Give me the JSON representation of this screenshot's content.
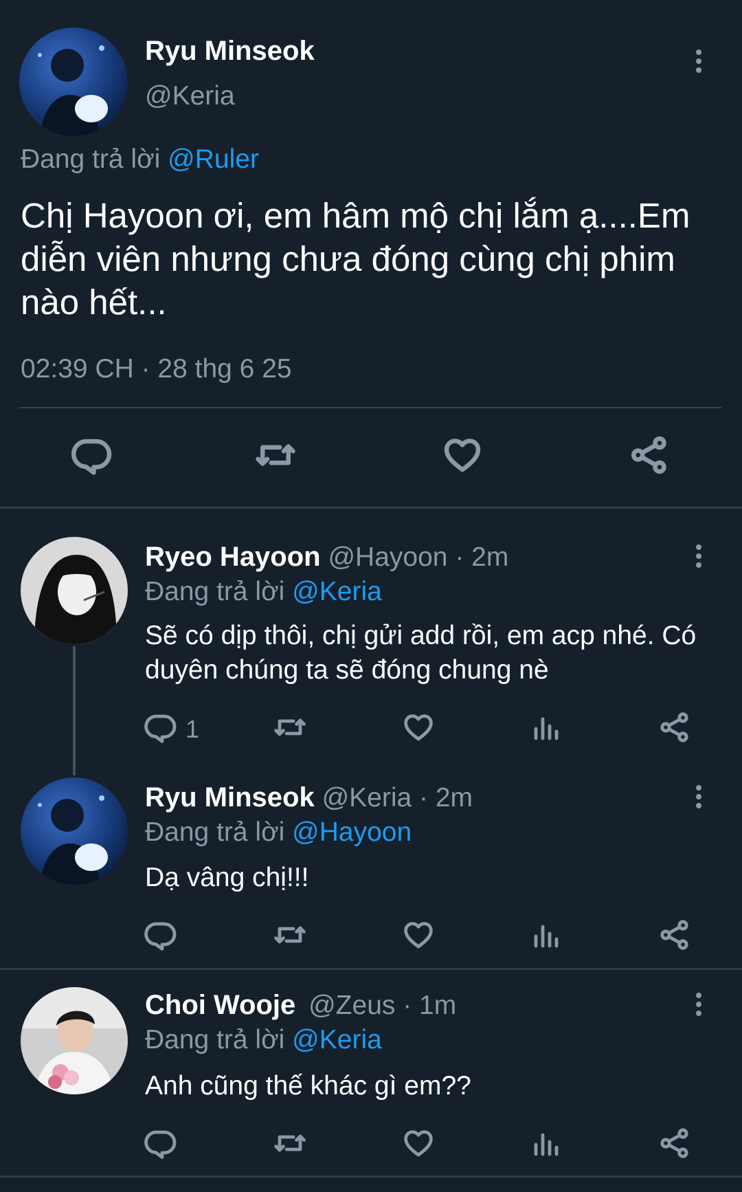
{
  "main_tweet": {
    "name": "Ryu Minseok",
    "handle": "@Keria",
    "replying_prefix": "Đang trả lời",
    "replying_to": "@Ruler",
    "text": "Chị Hayoon ơi, em hâm mộ chị lắm ạ....Em diễn viên nhưng chưa đóng cùng chị phim nào hết...",
    "timestamp": "02:39 CH · 28 thg 6 25",
    "actions": [
      "reply-icon",
      "retweet-icon",
      "like-icon",
      "share-icon"
    ]
  },
  "replies": [
    {
      "name": "Ryeo Hayoon",
      "handle": "@Hayoon",
      "time": "· 2m",
      "replying_prefix": "Đang trả lời",
      "replying_to": "@Keria",
      "text": "Sẽ có dịp thôi, chị gửi add rồi, em acp nhé. Có duyên chúng ta sẽ đóng chung nè",
      "reply_count": "1"
    },
    {
      "name": "Ryu Minseok",
      "handle": "@Keria",
      "time": "· 2m",
      "replying_prefix": "Đang trả lời",
      "replying_to": "@Hayoon",
      "text": "Dạ vâng chị!!!",
      "reply_count": ""
    },
    {
      "name": "Choi Wooje",
      "handle": "@Zeus",
      "time": "· 1m",
      "replying_prefix": "Đang trả lời",
      "replying_to": "@Keria",
      "text": "Anh cũng thế khác gì em??",
      "reply_count": ""
    }
  ],
  "colors": {
    "background": "#15202b",
    "link": "#1d9bf0",
    "muted": "#8899a6",
    "divider": "#38444d"
  }
}
